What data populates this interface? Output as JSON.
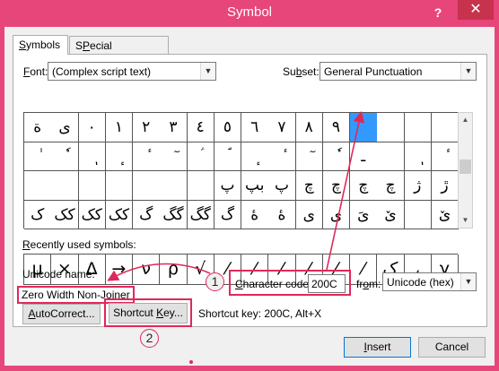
{
  "window": {
    "title": "Symbol",
    "help": "?",
    "close": "✕"
  },
  "tabs": [
    {
      "label": "Symbols",
      "mnemonic": "S",
      "rest": "ymbols"
    },
    {
      "label": "Special Characters",
      "mnemonic": "P",
      "pre": "S",
      "rest": "ecial Characters"
    }
  ],
  "font": {
    "label_m": "F",
    "label_rest": "ont:",
    "value": "(Complex script text)"
  },
  "subset": {
    "label_pre": "Su",
    "label_m": "b",
    "label_rest": "set:",
    "value": "General Punctuation"
  },
  "grid": {
    "rows": [
      [
        "ة",
        "ی",
        "٠",
        "١",
        "٢",
        "٣",
        "٤",
        "٥",
        "٦",
        "٧",
        "٨",
        "٩",
        "",
        "",
        "",
        ""
      ],
      [
        "ٰ",
        "ٗ",
        "ٖ",
        "ٕ",
        "ٔ",
        "ٓ",
        "ؑ",
        "ؐ",
        "ٕ",
        "ٔ",
        "ٓ",
        "ٗ",
        "ـ",
        "",
        "ٖ",
        "ٔ"
      ],
      [
        "",
        "",
        "",
        "",
        "",
        "",
        "",
        "پ",
        "بپ",
        "پ",
        "چ",
        "چ",
        "چ",
        "چ",
        "ژ",
        "ڙ"
      ],
      [
        "ک",
        "کک",
        "کک",
        "کک",
        "گ",
        "گگ",
        "گگ",
        "گ",
        "ۀ",
        "ۀ",
        "ی",
        "ی",
        "یَ",
        "ێ",
        "",
        "ێ"
      ]
    ],
    "selected": "0,12"
  },
  "recent": {
    "label_m": "R",
    "label_rest": "ecently used symbols:",
    "symbols": [
      "μ",
      "×",
      "Δ",
      "→",
      "ν",
      "ρ",
      "√",
      "⁄",
      "⁄",
      "⁄",
      "⁄",
      "⁄",
      "⁄",
      "ک",
      "،",
      "γ"
    ]
  },
  "unicode_name": {
    "label": "Unicode name:",
    "value": "Zero Width Non-Joiner"
  },
  "char_code": {
    "label_m": "C",
    "label_rest": "haracter code:",
    "value": "200C"
  },
  "from": {
    "label_pre": "fr",
    "label_m": "o",
    "label_rest": "m:",
    "value": "Unicode (hex)"
  },
  "buttons": {
    "autocorrect_m": "A",
    "autocorrect_rest": "utoCorrect...",
    "shortcut_pre": "Shortcut ",
    "shortcut_m": "K",
    "shortcut_rest": "ey...",
    "insert_m": "I",
    "insert_rest": "nsert",
    "cancel": "Cancel"
  },
  "shortcut_info": "Shortcut key: 200C, Alt+X",
  "callouts": [
    "1",
    "2"
  ],
  "colors": {
    "accent": "#e7467b",
    "highlight": "#e0285a",
    "selection": "#3399ff"
  }
}
